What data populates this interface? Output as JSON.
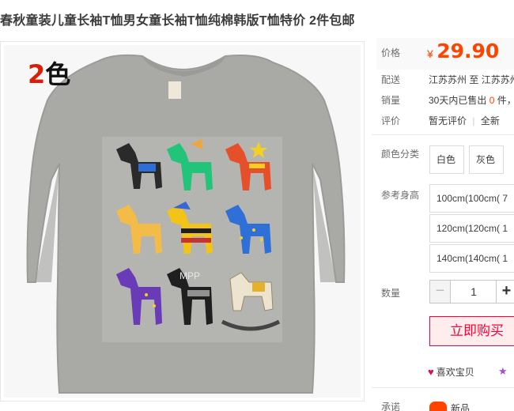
{
  "product": {
    "title": "春秋童装儿童长袖T恤男女童长袖T恤纯棉韩版T恤特价 2件包邮"
  },
  "gallery": {
    "overlay_number": "2",
    "overlay_text": "色",
    "watermark": "MPP"
  },
  "details": {
    "price_label": "价格",
    "currency": "¥",
    "price": "29.90",
    "shipping_label": "配送",
    "shipping_from": "江苏苏州",
    "shipping_to_word": "至",
    "shipping_to": "江苏苏州",
    "sales_label": "销量",
    "sales_prefix": "30天内已售出",
    "sales_count": "0",
    "sales_suffix": "件，",
    "review_label": "评价",
    "review_text": "暂无评价",
    "review_sep": "|",
    "review_new": "全新"
  },
  "options": {
    "color_label": "颜色分类",
    "colors": [
      "白色",
      "灰色"
    ],
    "size_label": "参考身高",
    "sizes": [
      "100cm(100cm( 7",
      "120cm(120cm( 1",
      "140cm(140cm( 1"
    ]
  },
  "quantity": {
    "label": "数量",
    "value": "1",
    "minus": "−",
    "plus": "+"
  },
  "actions": {
    "buy_now": "立即购买",
    "favorite": "喜欢宝贝",
    "favorite_icon": "heart-icon",
    "collect_icon": "star-icon"
  },
  "promise": {
    "label": "承诺",
    "new_item": "新品"
  },
  "colors": {
    "price": "#ff4400",
    "buy_border": "#ff0036",
    "buy_bg": "#ffeded"
  }
}
